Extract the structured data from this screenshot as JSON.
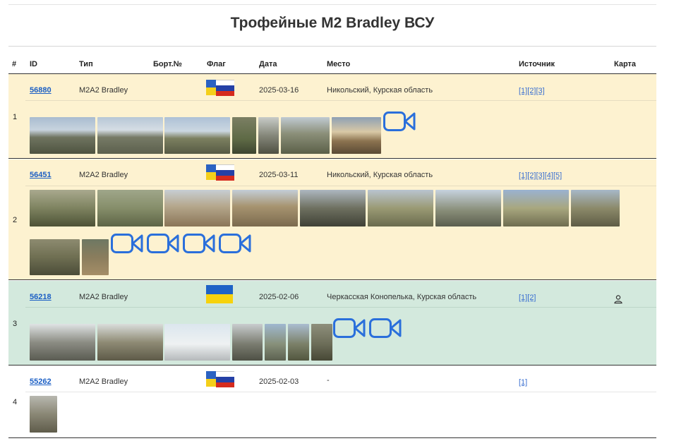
{
  "title": {
    "prefix": "Трофейные",
    "bold": "M2 Bradley",
    "suffix": "ВСУ"
  },
  "columns": {
    "num": "#",
    "id": "ID",
    "type": "Тип",
    "bort": "Борт.№",
    "flag": "Флаг",
    "date": "Дата",
    "place": "Место",
    "source": "Источник",
    "map": "Карта"
  },
  "rows": [
    {
      "num": "1",
      "id": "56880",
      "type": "M2A2 Bradley",
      "flag": "ua-ru",
      "date": "2025-03-16",
      "place": "Никольский, Курская область",
      "sources": [
        "[1]",
        "[2]",
        "[3]"
      ],
      "photos": 7,
      "videos": 1
    },
    {
      "num": "2",
      "id": "56451",
      "type": "M2A2 Bradley",
      "flag": "ua-ru",
      "date": "2025-03-11",
      "place": "Никольский, Курская область",
      "sources": [
        "[1]",
        "[2]",
        "[3]",
        "[4]",
        "[5]"
      ],
      "photos": 11,
      "videos": 4
    },
    {
      "num": "3",
      "id": "56218",
      "type": "M2A2 Bradley",
      "flag": "ua",
      "date": "2025-02-06",
      "place": "Черкасская Конопелька, Курская область",
      "sources": [
        "[1]",
        "[2]"
      ],
      "photos": 7,
      "videos": 2,
      "map": "person-icon"
    },
    {
      "num": "4",
      "id": "55262",
      "type": "M2A2 Bradley",
      "flag": "ua-ru",
      "date": "2025-02-03",
      "place": "-",
      "sources": [
        "[1]"
      ],
      "photos": 1,
      "videos": 0
    }
  ],
  "colors": {
    "row_yellow": "#fdf2d0",
    "row_green": "#d3e9dd",
    "link": "#1a5ec4",
    "video_icon": "#2a6fdb"
  }
}
